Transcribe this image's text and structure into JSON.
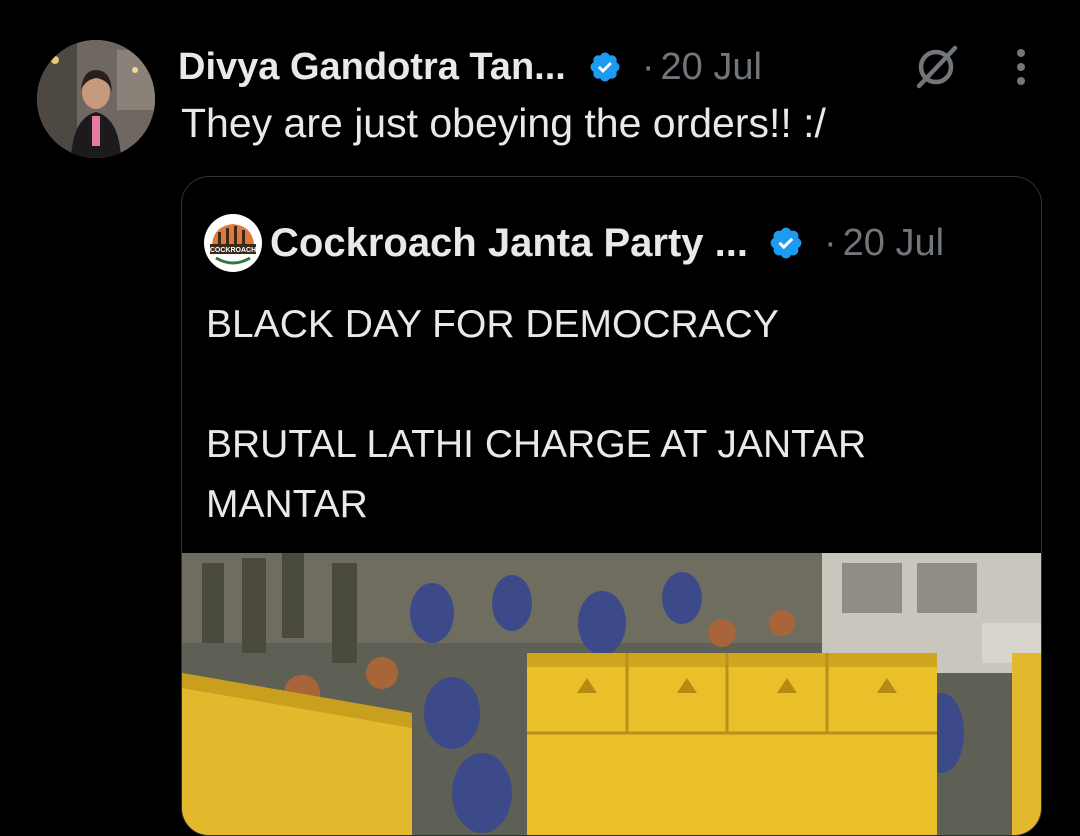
{
  "tweet": {
    "author_name": "Divya Gandotra Tan...",
    "dot": "·",
    "date": "20 Jul",
    "text": "They are just obeying the orders!! :/"
  },
  "quoted_tweet": {
    "author_name": "Cockroach Janta Party ...",
    "dot": "·",
    "date": "20 Jul",
    "avatar_text": "COCKROACH",
    "text_line1": "BLACK DAY FOR DEMOCRACY",
    "text_line2": "BRUTAL LATHI CHARGE AT JANTAR MANTAR"
  },
  "icons": {
    "verified": "verified-badge-icon",
    "grok": "grok-icon",
    "more": "more-vertical-icon"
  },
  "colors": {
    "background": "#000000",
    "text": "#e7e9ea",
    "secondary": "#71767b",
    "verified": "#1d9bf0",
    "border": "#2f3336"
  }
}
